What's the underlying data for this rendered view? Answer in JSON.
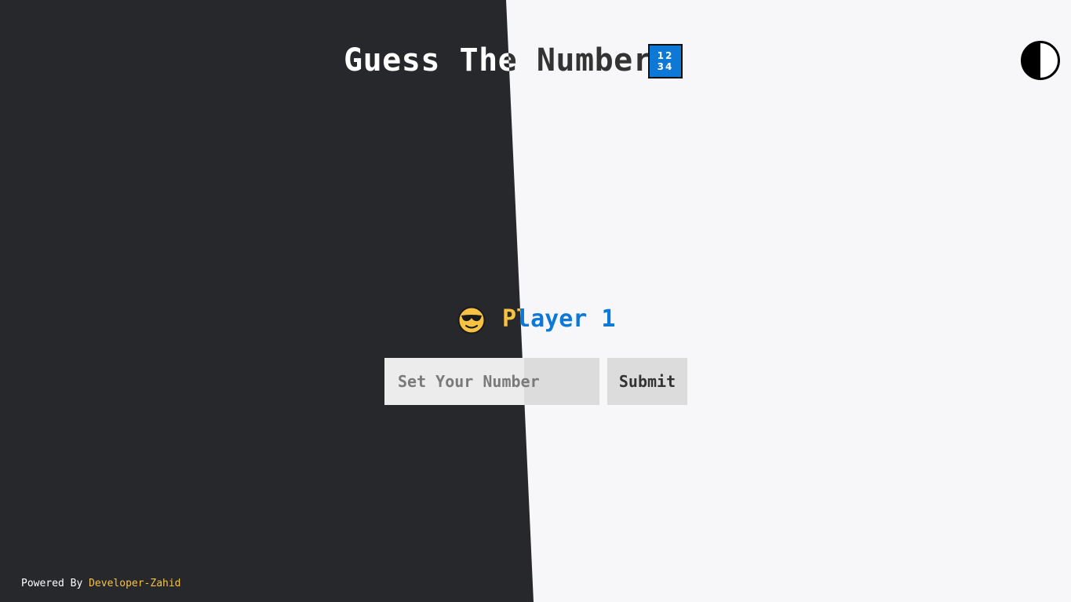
{
  "app": {
    "title": "Guess The Number",
    "title_icon_text": "12 34",
    "title_icon_name": "input-numbers-icon"
  },
  "theme_toggle": {
    "icon_name": "half-circle-contrast-icon"
  },
  "player": {
    "emoji_name": "sunglasses-face-icon",
    "label": "Player 1"
  },
  "form": {
    "input_placeholder": "Set Your Number",
    "input_value": "",
    "submit_label": "Submit"
  },
  "footer": {
    "prefix": "Powered By",
    "author_link": "Developer-Zahid"
  },
  "colors": {
    "dark_bg": "#26282c",
    "light_bg": "#f7f7f9",
    "accent_yellow": "#f6c244",
    "accent_blue": "#0d78d6"
  }
}
